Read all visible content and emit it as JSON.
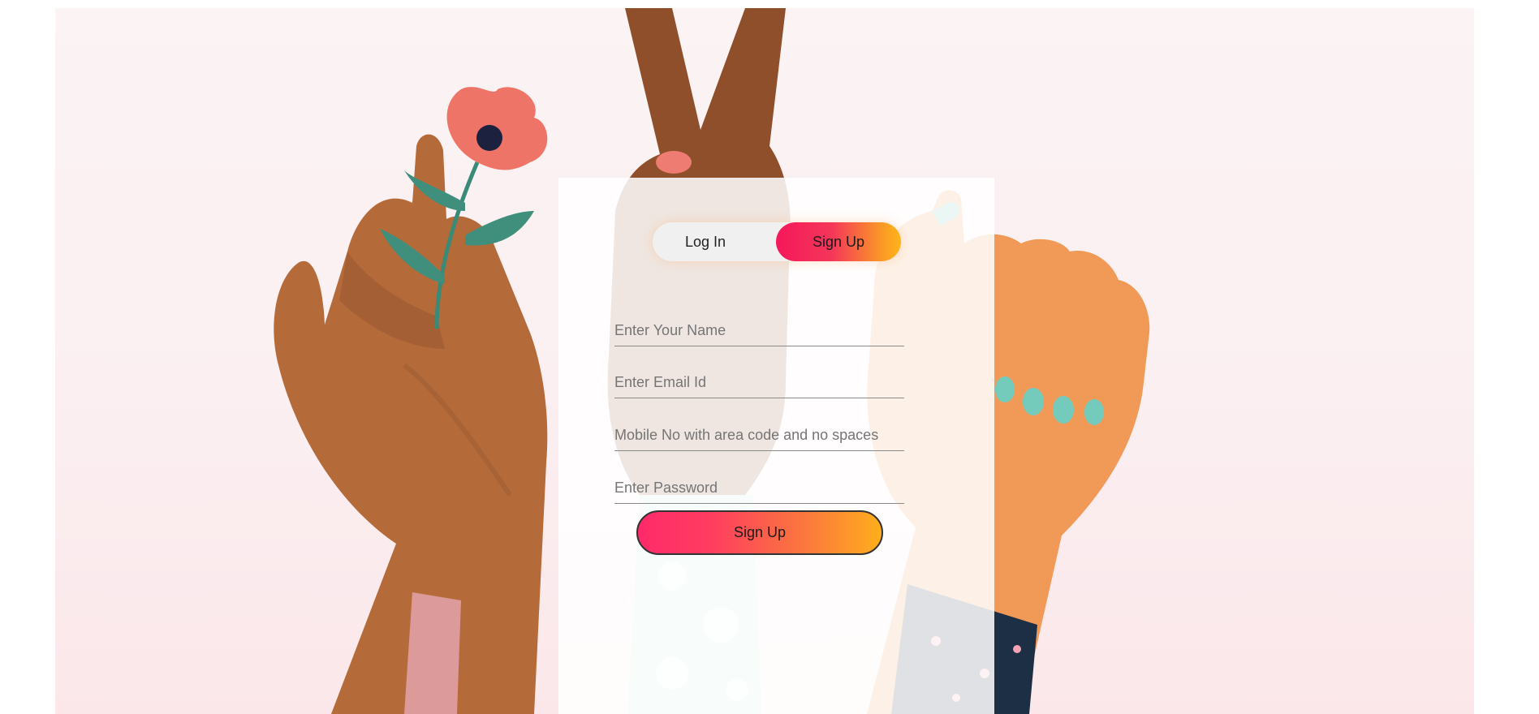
{
  "auth_tabs": {
    "login_label": "Log In",
    "signup_label": "Sign Up",
    "active_tab": "Sign Up"
  },
  "signup_form": {
    "name_placeholder": "Enter Your Name",
    "email_placeholder": "Enter Email Id",
    "mobile_placeholder": "Mobile No with area code and no spaces",
    "password_placeholder": "Enter Password",
    "submit_label": "Sign Up"
  },
  "colors": {
    "accent_start": "#f5175a",
    "accent_end": "#ffb51a",
    "background_tint": "#fbeff1"
  }
}
